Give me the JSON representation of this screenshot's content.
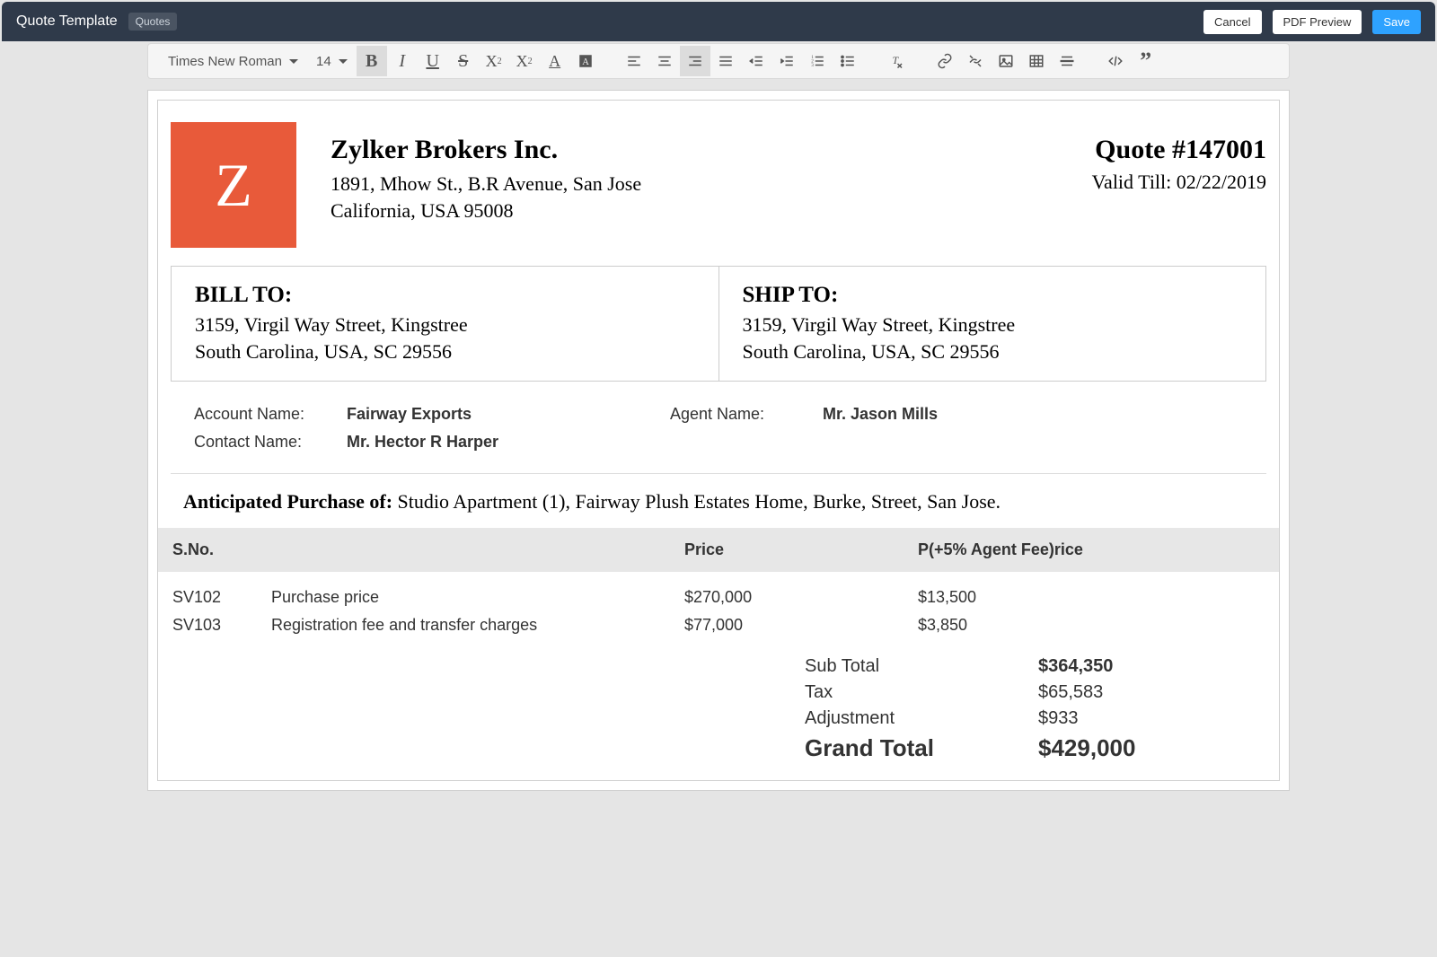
{
  "header": {
    "title": "Quote Template",
    "badge": "Quotes",
    "cancel": "Cancel",
    "preview": "PDF Preview",
    "save": "Save"
  },
  "toolbar": {
    "font": "Times New Roman",
    "size": "14"
  },
  "company": {
    "logo_letter": "Z",
    "logo_color": "#e85a3a",
    "name": "Zylker Brokers Inc.",
    "addr1": "1891, Mhow St., B.R Avenue, San Jose",
    "addr2": "California, USA 95008"
  },
  "quote": {
    "number": "Quote #147001",
    "valid": "Valid Till: 02/22/2019"
  },
  "bill": {
    "title": "BILL TO:",
    "line1": "3159, Virgil Way Street, Kingstree",
    "line2": "South Carolina, USA, SC 29556"
  },
  "ship": {
    "title": "SHIP TO:",
    "line1": "3159, Virgil Way Street, Kingstree",
    "line2": "South Carolina, USA, SC 29556"
  },
  "info": {
    "account_label": "Account Name:",
    "account_value": "Fairway Exports",
    "agent_label": "Agent Name:",
    "agent_value": "Mr. Jason Mills",
    "contact_label": "Contact Name:",
    "contact_value": "Mr. Hector R Harper"
  },
  "purchase": {
    "label": "Anticipated Purchase of:",
    "text": " Studio Apartment (1), Fairway Plush Estates Home, Burke, Street, San Jose."
  },
  "table": {
    "headers": {
      "sno": "S.No.",
      "desc": "",
      "price": "Price",
      "fee": "P(+5% Agent Fee)rice"
    },
    "rows": [
      {
        "sno": "SV102",
        "desc": "Purchase price",
        "price": "$270,000",
        "fee": "$13,500"
      },
      {
        "sno": "SV103",
        "desc": "Registration fee and transfer charges",
        "price": "$77,000",
        "fee": "$3,850"
      }
    ]
  },
  "totals": {
    "subtotal_label": "Sub Total",
    "subtotal_value": "$364,350",
    "tax_label": "Tax",
    "tax_value": "$65,583",
    "adjustment_label": "Adjustment",
    "adjustment_value": "$933",
    "grand_label": "Grand Total",
    "grand_value": "$429,000"
  }
}
